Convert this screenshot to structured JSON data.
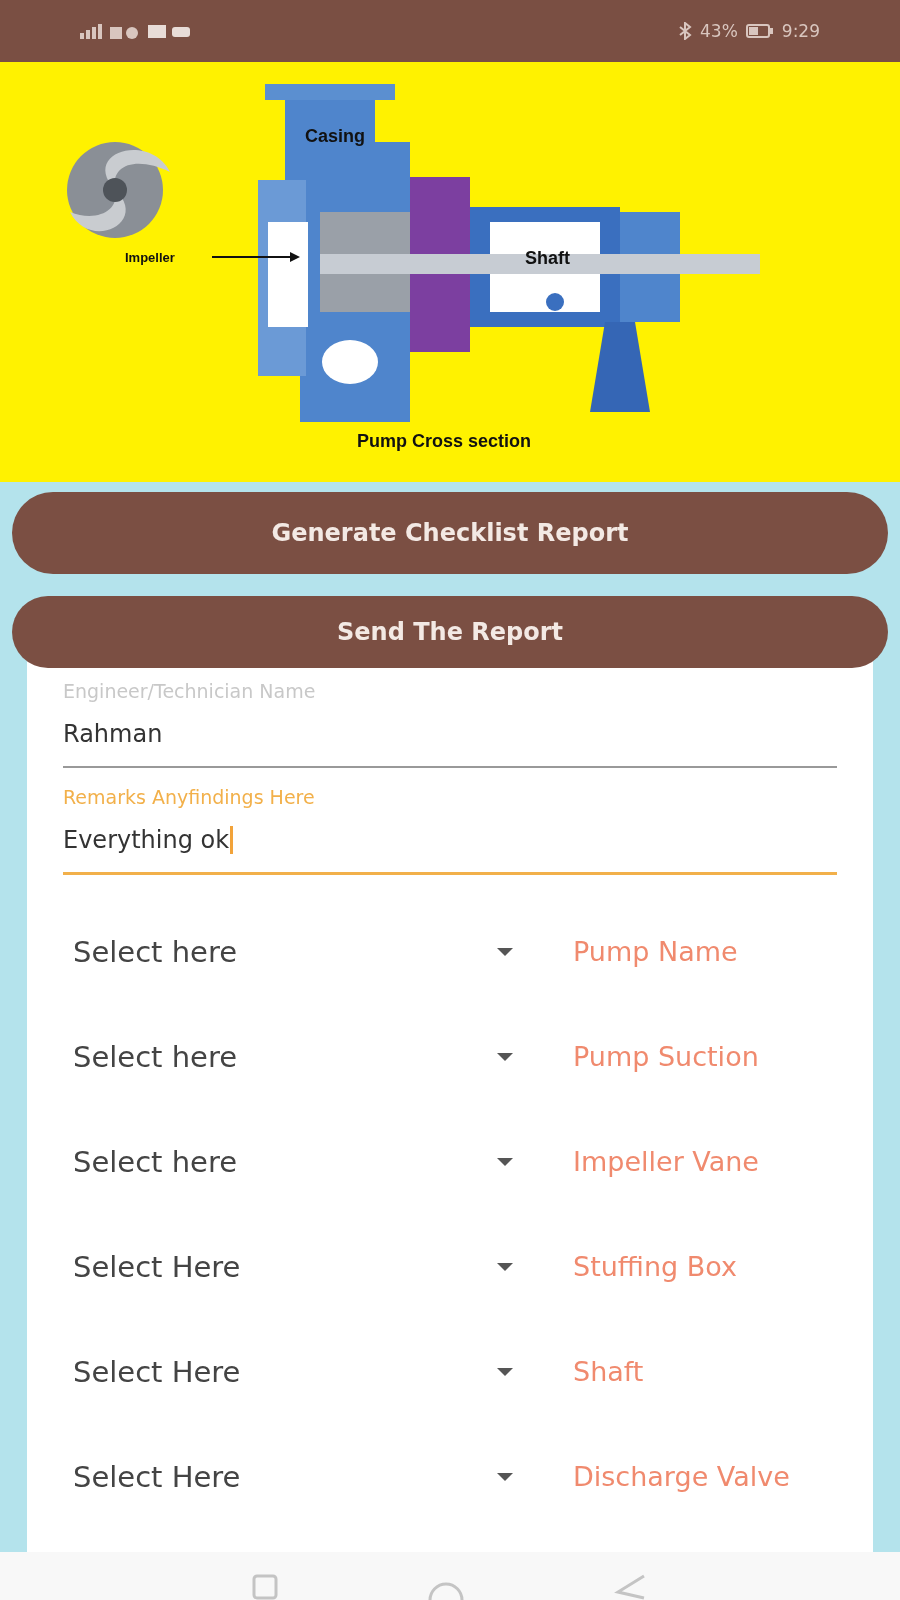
{
  "status_bar": {
    "battery": "43%",
    "time": "9:29"
  },
  "diagram": {
    "casing_label": "Casing",
    "impeller_label": "Impeller",
    "shaft_label": "Shaft",
    "caption": "Pump Cross section"
  },
  "buttons": [
    "Generate Checklist Report",
    "Send The Report"
  ],
  "fields": [
    {
      "label": "Engineer/Technician Name",
      "value": "Rahman",
      "focused": false
    },
    {
      "label": "Remarks Anyfindings Here",
      "value": "Everything ok",
      "focused": true
    }
  ],
  "checklist": [
    {
      "value": "Select here",
      "label": "Pump Name"
    },
    {
      "value": "Select here",
      "label": "Pump Suction"
    },
    {
      "value": "Select here",
      "label": "Impeller Vane"
    },
    {
      "value": "Select Here",
      "label": "Stuffing Box"
    },
    {
      "value": "Select Here",
      "label": "Shaft"
    },
    {
      "value": "Select Here",
      "label": "Discharge Valve"
    }
  ]
}
